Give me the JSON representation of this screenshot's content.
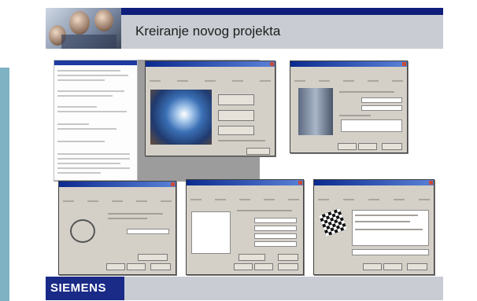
{
  "slide": {
    "title": "Kreiranje novog projekta",
    "topbar_text": "",
    "footer": {
      "logo": "SIEMENS",
      "left_text": "",
      "right_text": ""
    }
  },
  "colors": {
    "navy": "#1a2a87",
    "title_band": "#c9ccd3",
    "accent_bar": "#7fb3c3",
    "dialog_face": "#d4d0c8"
  },
  "screenshots": [
    {
      "name": "project-document"
    },
    {
      "name": "wizard-welcome-dialog"
    },
    {
      "name": "wizard-cpu-dialog"
    },
    {
      "name": "wizard-interface-dialog"
    },
    {
      "name": "wizard-blocks-dialog"
    },
    {
      "name": "wizard-finish-dialog"
    }
  ]
}
